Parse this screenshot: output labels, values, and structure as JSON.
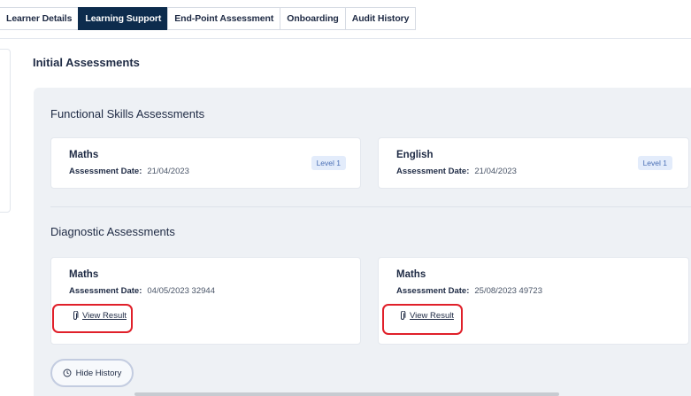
{
  "tabs": [
    {
      "label": "Learner Details",
      "active": false
    },
    {
      "label": "Learning Support",
      "active": true
    },
    {
      "label": "End-Point Assessment",
      "active": false
    },
    {
      "label": "Onboarding",
      "active": false
    },
    {
      "label": "Audit History",
      "active": false
    }
  ],
  "page_title": "Initial Assessments",
  "functional": {
    "title": "Functional Skills Assessments",
    "cards": [
      {
        "subject": "Maths",
        "date_label": "Assessment Date:",
        "date_value": "21/04/2023",
        "level": "Level 1"
      },
      {
        "subject": "English",
        "date_label": "Assessment Date:",
        "date_value": "21/04/2023",
        "level": "Level 1"
      }
    ]
  },
  "diagnostic": {
    "title": "Diagnostic Assessments",
    "cards": [
      {
        "subject": "Maths",
        "date_label": "Assessment Date:",
        "date_value": "04/05/2023 32944",
        "link": "View Result"
      },
      {
        "subject": "Maths",
        "date_label": "Assessment Date:",
        "date_value": "25/08/2023 49723",
        "link": "View Result"
      }
    ]
  },
  "hide_history_label": "Hide History",
  "icons": {
    "attachment": "paperclip-icon",
    "history": "clock-icon"
  },
  "colors": {
    "active_tab": "#0d2c4d",
    "highlight": "#e0202a",
    "badge_bg": "#e3ecfb",
    "badge_text": "#4a6fb5"
  }
}
